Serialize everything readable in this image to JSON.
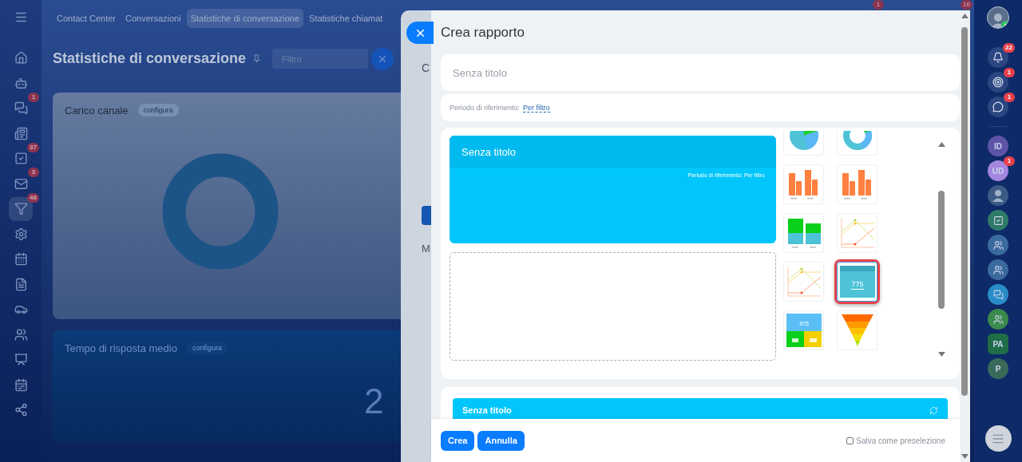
{
  "left_nav": [
    {
      "kind": "menu",
      "selected": false
    },
    {
      "kind": "home",
      "selected": false
    },
    {
      "kind": "bot",
      "selected": false
    },
    {
      "kind": "chat",
      "badge": "1",
      "selected": false
    },
    {
      "kind": "feed",
      "selected": false
    },
    {
      "kind": "tasks",
      "badge": "37",
      "selected": false
    },
    {
      "kind": "mail",
      "badge": "3",
      "selected": false
    },
    {
      "kind": "funnel",
      "badge": "48",
      "selected": true
    },
    {
      "kind": "settings",
      "selected": false
    },
    {
      "kind": "calendar",
      "selected": false
    },
    {
      "kind": "document",
      "selected": false
    },
    {
      "kind": "car",
      "selected": false
    },
    {
      "kind": "contacts",
      "selected": false
    },
    {
      "kind": "presentation",
      "selected": false
    },
    {
      "kind": "planner",
      "selected": false
    },
    {
      "kind": "share",
      "selected": false
    }
  ],
  "top_tabs": [
    {
      "label": "Contact Center",
      "selected": false
    },
    {
      "label": "Conversazioni",
      "selected": false
    },
    {
      "label": "Statistiche di conversazione",
      "selected": true
    },
    {
      "label": "Statistiche chiamat",
      "selected": false
    }
  ],
  "top_badges": [
    "1",
    "16"
  ],
  "page": {
    "title": "Statistiche di conversazione",
    "filter": {
      "placeholder": "Filtro"
    },
    "cards": [
      {
        "kind": "donut",
        "title": "Carico canale",
        "action": "configura"
      },
      {
        "kind": "number",
        "title": "Tempo di risposta medio",
        "action": "configura",
        "value": "2"
      }
    ]
  },
  "back_panel": {
    "heading": "C",
    "section": "M"
  },
  "dialog": {
    "title": "Crea rapporto",
    "name_field": {
      "placeholder": "Senza titolo"
    },
    "period": {
      "label": "Periodo di riferimento:",
      "link": "Per filtro"
    },
    "preview": {
      "title": "Senza titolo",
      "period": "Periodo di riferimento: Per filtro"
    },
    "chart_types": [
      {
        "kind": "pie",
        "selected": false
      },
      {
        "kind": "donut",
        "selected": false
      },
      {
        "kind": "bar",
        "selected": false
      },
      {
        "kind": "bar",
        "selected": false
      },
      {
        "kind": "stacked",
        "selected": false
      },
      {
        "kind": "line",
        "selected": false
      },
      {
        "kind": "line",
        "selected": false
      },
      {
        "kind": "number",
        "value": "775",
        "selected": true
      },
      {
        "kind": "tiles",
        "value": "975",
        "selected": false
      },
      {
        "kind": "funnel",
        "selected": false
      }
    ],
    "widget": {
      "title": "Senza titolo"
    },
    "buttons": [
      "Crea",
      "Annulla"
    ],
    "save_preset": {
      "label": "Salva come preselezione",
      "checked": false
    }
  },
  "right_rail": [
    {
      "kind": "bell",
      "badge": "22"
    },
    {
      "kind": "target",
      "badge": "1"
    },
    {
      "kind": "chat",
      "badge": "1"
    },
    {
      "kind": "divider"
    },
    {
      "kind": "initials",
      "text": "ID",
      "color": "#5d54a8"
    },
    {
      "kind": "initials",
      "text": "UD",
      "color": "#a587e0",
      "badge": "1"
    },
    {
      "kind": "avatar",
      "color": "#3c5a86"
    },
    {
      "kind": "check",
      "color": "#2f7a68"
    },
    {
      "kind": "group",
      "color": "#3a6a9e"
    },
    {
      "kind": "group",
      "color": "#3a6a9e"
    },
    {
      "kind": "messages",
      "color": "#2a8cc8"
    },
    {
      "kind": "group",
      "color": "#3a8a4c"
    },
    {
      "kind": "hex",
      "text": "PA",
      "color": "#1f6e48"
    },
    {
      "kind": "initials",
      "text": "P",
      "color": "#3a6a5a"
    }
  ]
}
